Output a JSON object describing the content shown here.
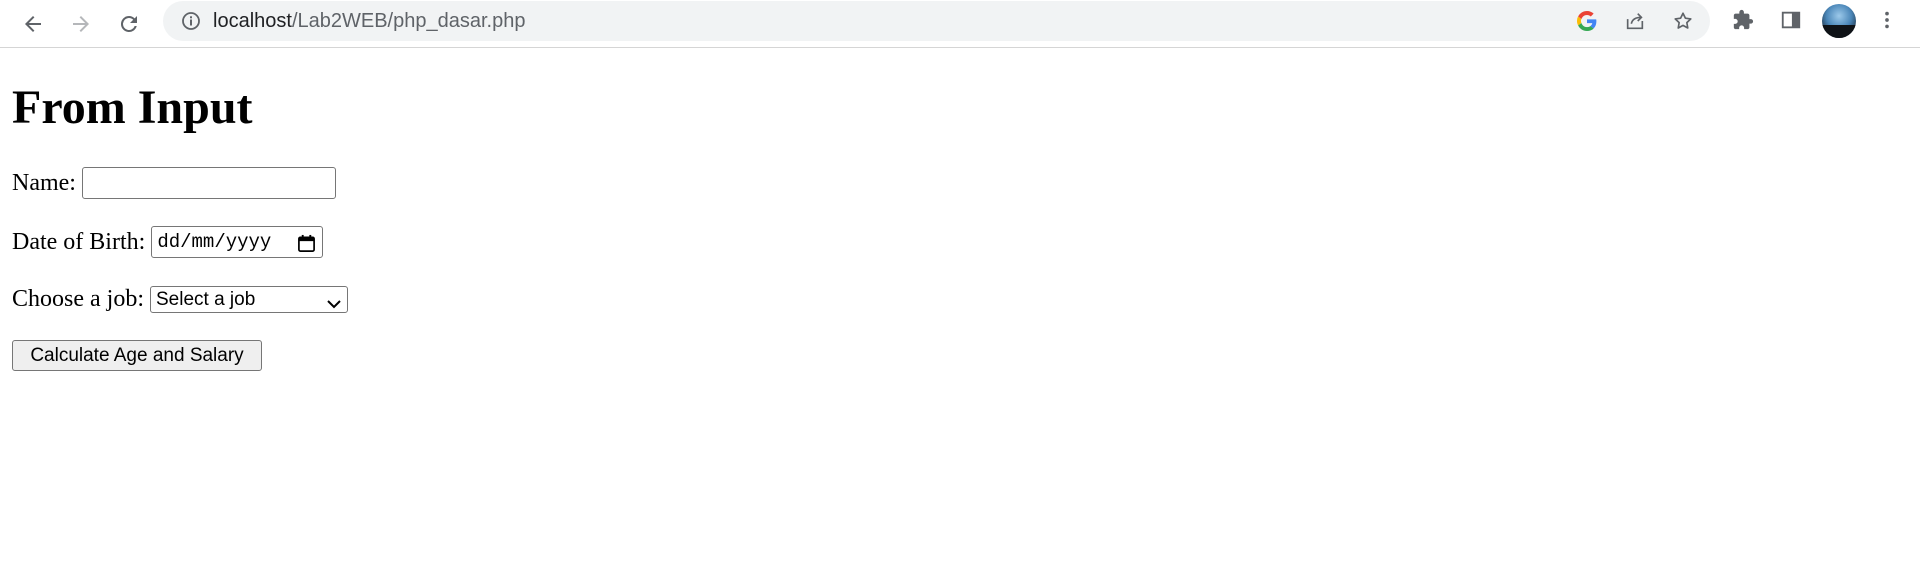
{
  "browser": {
    "url_host": "localhost",
    "url_path": "/Lab2WEB/php_dasar.php",
    "google_color": "#4285f4"
  },
  "page": {
    "heading": "From Input",
    "name_label": "Name:",
    "name_value": "",
    "dob_label": "Date of Birth:",
    "dob_placeholder": "dd/mm/yyyy",
    "job_label": "Choose a job:",
    "job_selected": "Select a job",
    "submit_label": "Calculate Age and Salary"
  }
}
